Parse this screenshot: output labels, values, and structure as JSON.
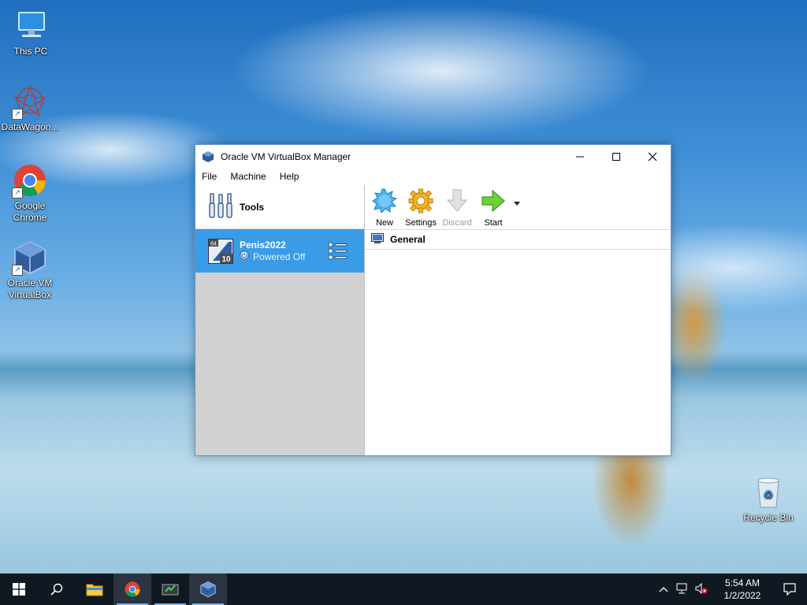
{
  "desktop": {
    "icons": [
      {
        "label": "This PC",
        "icon": "computer-icon"
      },
      {
        "label": "DataWagon...",
        "icon": "datawagon-icon"
      },
      {
        "label": "Google Chrome",
        "icon": "chrome-icon"
      },
      {
        "label": "Oracle VM VirtualBox",
        "icon": "virtualbox-icon"
      },
      {
        "label": "Recycle Bin",
        "icon": "recycle-bin-icon"
      }
    ]
  },
  "window": {
    "title": "Oracle VM VirtualBox Manager",
    "controls": {
      "minimize": "—",
      "maximize": "☐",
      "close": "✕"
    },
    "menu": [
      "File",
      "Machine",
      "Help"
    ],
    "tools_label": "Tools",
    "vm": {
      "name": "Penis2022",
      "state": "Powered Off",
      "os_badge_top": "64",
      "os_badge_bottom": "10"
    },
    "toolbar": [
      {
        "label": "New",
        "icon": "new-icon",
        "enabled": true
      },
      {
        "label": "Settings",
        "icon": "settings-gear-icon",
        "enabled": true
      },
      {
        "label": "Discard",
        "icon": "discard-arrow-icon",
        "enabled": false
      },
      {
        "label": "Start",
        "icon": "start-arrow-icon",
        "enabled": true
      }
    ],
    "details_section": "General"
  },
  "taskbar": {
    "clock": {
      "time": "5:54 AM",
      "date": "1/2/2022"
    },
    "apps": [
      "start-icon",
      "search-icon",
      "file-explorer-icon",
      "chrome-icon",
      "app-icon",
      "virtualbox-icon"
    ]
  },
  "colors": {
    "selection": "#3a9ce6",
    "taskbar": "#101822"
  }
}
